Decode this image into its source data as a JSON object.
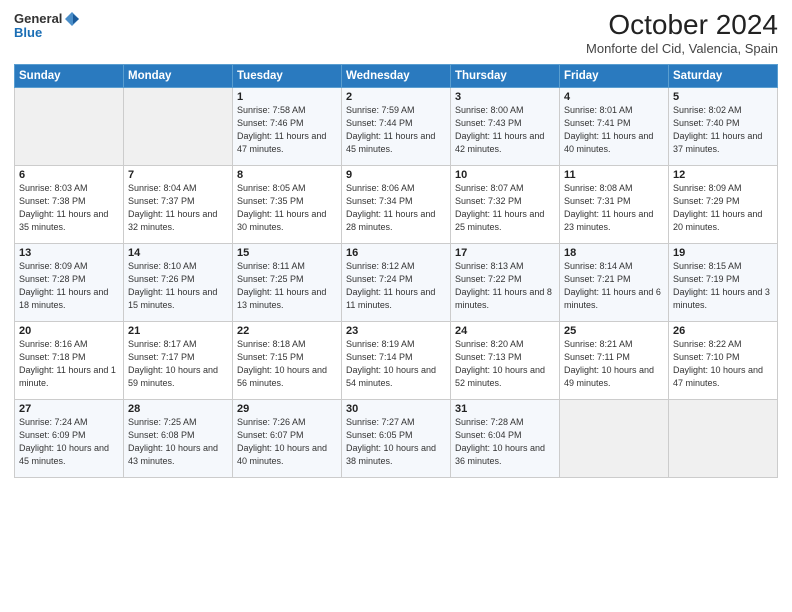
{
  "header": {
    "logo_line1": "General",
    "logo_line2": "Blue",
    "title": "October 2024",
    "subtitle": "Monforte del Cid, Valencia, Spain"
  },
  "days_of_week": [
    "Sunday",
    "Monday",
    "Tuesday",
    "Wednesday",
    "Thursday",
    "Friday",
    "Saturday"
  ],
  "weeks": [
    [
      {
        "day": "",
        "sunrise": "",
        "sunset": "",
        "daylight": ""
      },
      {
        "day": "",
        "sunrise": "",
        "sunset": "",
        "daylight": ""
      },
      {
        "day": "1",
        "sunrise": "Sunrise: 7:58 AM",
        "sunset": "Sunset: 7:46 PM",
        "daylight": "Daylight: 11 hours and 47 minutes."
      },
      {
        "day": "2",
        "sunrise": "Sunrise: 7:59 AM",
        "sunset": "Sunset: 7:44 PM",
        "daylight": "Daylight: 11 hours and 45 minutes."
      },
      {
        "day": "3",
        "sunrise": "Sunrise: 8:00 AM",
        "sunset": "Sunset: 7:43 PM",
        "daylight": "Daylight: 11 hours and 42 minutes."
      },
      {
        "day": "4",
        "sunrise": "Sunrise: 8:01 AM",
        "sunset": "Sunset: 7:41 PM",
        "daylight": "Daylight: 11 hours and 40 minutes."
      },
      {
        "day": "5",
        "sunrise": "Sunrise: 8:02 AM",
        "sunset": "Sunset: 7:40 PM",
        "daylight": "Daylight: 11 hours and 37 minutes."
      }
    ],
    [
      {
        "day": "6",
        "sunrise": "Sunrise: 8:03 AM",
        "sunset": "Sunset: 7:38 PM",
        "daylight": "Daylight: 11 hours and 35 minutes."
      },
      {
        "day": "7",
        "sunrise": "Sunrise: 8:04 AM",
        "sunset": "Sunset: 7:37 PM",
        "daylight": "Daylight: 11 hours and 32 minutes."
      },
      {
        "day": "8",
        "sunrise": "Sunrise: 8:05 AM",
        "sunset": "Sunset: 7:35 PM",
        "daylight": "Daylight: 11 hours and 30 minutes."
      },
      {
        "day": "9",
        "sunrise": "Sunrise: 8:06 AM",
        "sunset": "Sunset: 7:34 PM",
        "daylight": "Daylight: 11 hours and 28 minutes."
      },
      {
        "day": "10",
        "sunrise": "Sunrise: 8:07 AM",
        "sunset": "Sunset: 7:32 PM",
        "daylight": "Daylight: 11 hours and 25 minutes."
      },
      {
        "day": "11",
        "sunrise": "Sunrise: 8:08 AM",
        "sunset": "Sunset: 7:31 PM",
        "daylight": "Daylight: 11 hours and 23 minutes."
      },
      {
        "day": "12",
        "sunrise": "Sunrise: 8:09 AM",
        "sunset": "Sunset: 7:29 PM",
        "daylight": "Daylight: 11 hours and 20 minutes."
      }
    ],
    [
      {
        "day": "13",
        "sunrise": "Sunrise: 8:09 AM",
        "sunset": "Sunset: 7:28 PM",
        "daylight": "Daylight: 11 hours and 18 minutes."
      },
      {
        "day": "14",
        "sunrise": "Sunrise: 8:10 AM",
        "sunset": "Sunset: 7:26 PM",
        "daylight": "Daylight: 11 hours and 15 minutes."
      },
      {
        "day": "15",
        "sunrise": "Sunrise: 8:11 AM",
        "sunset": "Sunset: 7:25 PM",
        "daylight": "Daylight: 11 hours and 13 minutes."
      },
      {
        "day": "16",
        "sunrise": "Sunrise: 8:12 AM",
        "sunset": "Sunset: 7:24 PM",
        "daylight": "Daylight: 11 hours and 11 minutes."
      },
      {
        "day": "17",
        "sunrise": "Sunrise: 8:13 AM",
        "sunset": "Sunset: 7:22 PM",
        "daylight": "Daylight: 11 hours and 8 minutes."
      },
      {
        "day": "18",
        "sunrise": "Sunrise: 8:14 AM",
        "sunset": "Sunset: 7:21 PM",
        "daylight": "Daylight: 11 hours and 6 minutes."
      },
      {
        "day": "19",
        "sunrise": "Sunrise: 8:15 AM",
        "sunset": "Sunset: 7:19 PM",
        "daylight": "Daylight: 11 hours and 3 minutes."
      }
    ],
    [
      {
        "day": "20",
        "sunrise": "Sunrise: 8:16 AM",
        "sunset": "Sunset: 7:18 PM",
        "daylight": "Daylight: 11 hours and 1 minute."
      },
      {
        "day": "21",
        "sunrise": "Sunrise: 8:17 AM",
        "sunset": "Sunset: 7:17 PM",
        "daylight": "Daylight: 10 hours and 59 minutes."
      },
      {
        "day": "22",
        "sunrise": "Sunrise: 8:18 AM",
        "sunset": "Sunset: 7:15 PM",
        "daylight": "Daylight: 10 hours and 56 minutes."
      },
      {
        "day": "23",
        "sunrise": "Sunrise: 8:19 AM",
        "sunset": "Sunset: 7:14 PM",
        "daylight": "Daylight: 10 hours and 54 minutes."
      },
      {
        "day": "24",
        "sunrise": "Sunrise: 8:20 AM",
        "sunset": "Sunset: 7:13 PM",
        "daylight": "Daylight: 10 hours and 52 minutes."
      },
      {
        "day": "25",
        "sunrise": "Sunrise: 8:21 AM",
        "sunset": "Sunset: 7:11 PM",
        "daylight": "Daylight: 10 hours and 49 minutes."
      },
      {
        "day": "26",
        "sunrise": "Sunrise: 8:22 AM",
        "sunset": "Sunset: 7:10 PM",
        "daylight": "Daylight: 10 hours and 47 minutes."
      }
    ],
    [
      {
        "day": "27",
        "sunrise": "Sunrise: 7:24 AM",
        "sunset": "Sunset: 6:09 PM",
        "daylight": "Daylight: 10 hours and 45 minutes."
      },
      {
        "day": "28",
        "sunrise": "Sunrise: 7:25 AM",
        "sunset": "Sunset: 6:08 PM",
        "daylight": "Daylight: 10 hours and 43 minutes."
      },
      {
        "day": "29",
        "sunrise": "Sunrise: 7:26 AM",
        "sunset": "Sunset: 6:07 PM",
        "daylight": "Daylight: 10 hours and 40 minutes."
      },
      {
        "day": "30",
        "sunrise": "Sunrise: 7:27 AM",
        "sunset": "Sunset: 6:05 PM",
        "daylight": "Daylight: 10 hours and 38 minutes."
      },
      {
        "day": "31",
        "sunrise": "Sunrise: 7:28 AM",
        "sunset": "Sunset: 6:04 PM",
        "daylight": "Daylight: 10 hours and 36 minutes."
      },
      {
        "day": "",
        "sunrise": "",
        "sunset": "",
        "daylight": ""
      },
      {
        "day": "",
        "sunrise": "",
        "sunset": "",
        "daylight": ""
      }
    ]
  ]
}
